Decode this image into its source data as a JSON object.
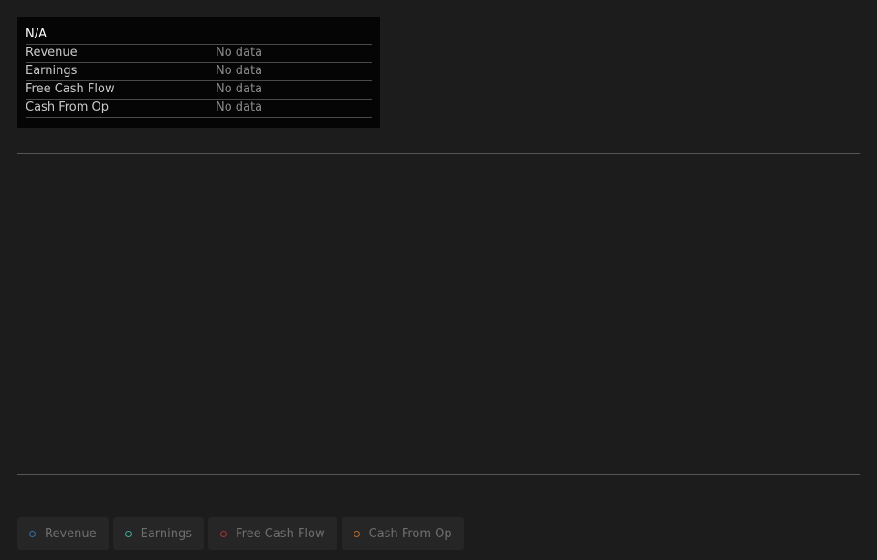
{
  "tooltip": {
    "title": "N/A",
    "rows": [
      {
        "label": "Revenue",
        "value": "No data"
      },
      {
        "label": "Earnings",
        "value": "No data"
      },
      {
        "label": "Free Cash Flow",
        "value": "No data"
      },
      {
        "label": "Cash From Op",
        "value": "No data"
      }
    ]
  },
  "legend": {
    "items": [
      {
        "label": "Revenue",
        "color": "#2f6fb0"
      },
      {
        "label": "Earnings",
        "color": "#3aa89a"
      },
      {
        "label": "Free Cash Flow",
        "color": "#a8323a"
      },
      {
        "label": "Cash From Op",
        "color": "#b86b2f"
      }
    ]
  }
}
